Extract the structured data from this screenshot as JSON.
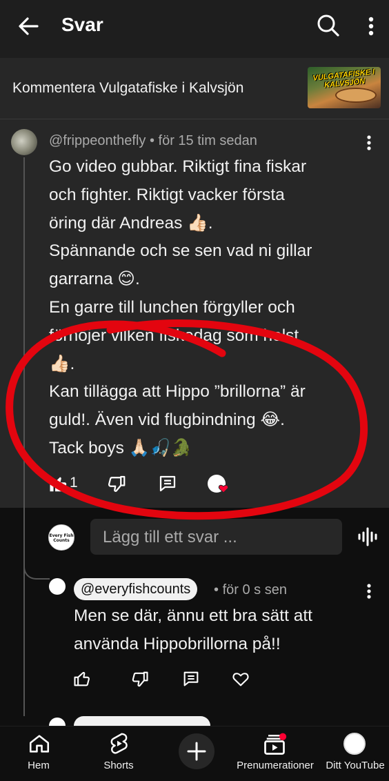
{
  "header": {
    "title": "Svar",
    "back_icon": "arrow-left-icon",
    "search_icon": "search-icon",
    "more_icon": "more-vertical-icon"
  },
  "video_ref": {
    "text": "Kommentera Vulgatafiske i Kalvsjön",
    "thumbnail_title": "VULGATAFISKE I KALVSJÖN"
  },
  "comment": {
    "author": "@frippeonthefly",
    "time": "för 15 tim sedan",
    "lines": [
      "Go video gubbar. Riktigt fina fiskar",
      "och fighter. Riktigt vacker första",
      "öring där Andreas 👍🏻.",
      "Spännande och se sen vad ni gillar",
      "garrarna 😊.",
      "En garre till lunchen förgyller och",
      "förhöjer vilken fiskedag som helst",
      "👍🏻.",
      "Kan tillägga att Hippo ”brillorna” är",
      "guld!. Även vid flugbindning 😂.",
      "Tack boys 🙏🏻🎣🐊"
    ],
    "like_count": "1",
    "creator_heart": true
  },
  "reply_box": {
    "placeholder": "Lägg till ett svar ..."
  },
  "reply": {
    "author": "@everyfishcounts",
    "time": "för 0 s sen",
    "lines": [
      "Men se där, ännu ett bra sätt att",
      "använda Hippobrillorna på!!"
    ]
  },
  "brand_mini": "Every Fish Counts",
  "bottom_nav": {
    "items": [
      {
        "label": "Hem",
        "icon": "home-icon"
      },
      {
        "label": "Shorts",
        "icon": "shorts-icon"
      },
      {
        "label": "",
        "icon": "plus-icon"
      },
      {
        "label": "Prenumerationer",
        "icon": "subscriptions-icon"
      },
      {
        "label": "Ditt YouTube",
        "icon": "account-avatar-icon"
      }
    ]
  },
  "colors": {
    "background": "#0f0f0f",
    "panel": "#272727",
    "secondary_text": "#aaaaaa",
    "annotation_red": "#e3050f",
    "notification_red": "#ff0033"
  }
}
